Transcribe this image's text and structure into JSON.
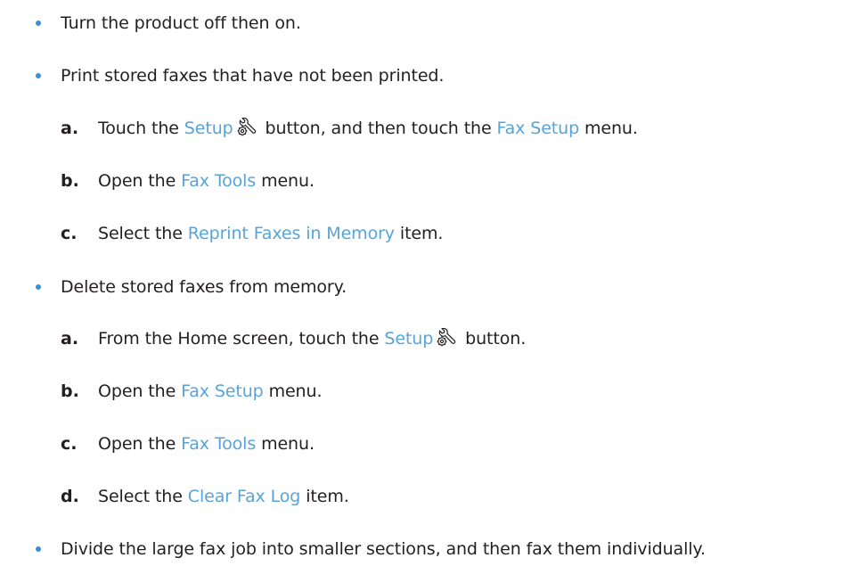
{
  "steps": [
    {
      "text": "Turn the product off then on."
    },
    {
      "text": "Print stored faxes that have not been printed.",
      "sub": [
        {
          "letter": "a.",
          "pre": "Touch the ",
          "ui1": "Setup",
          "mid": " button, and then touch the ",
          "ui2": "Fax Setup",
          "post": " menu.",
          "icon": "wrench-gear-icon"
        },
        {
          "letter": "b.",
          "pre": "Open the ",
          "ui1": "Fax Tools",
          "post": " menu."
        },
        {
          "letter": "c.",
          "pre": "Select the ",
          "ui1": "Reprint Faxes in Memory",
          "post": " item."
        }
      ]
    },
    {
      "text": "Delete stored faxes from memory.",
      "sub": [
        {
          "letter": "a.",
          "pre": "From the Home screen, touch the ",
          "ui1": "Setup",
          "post": " button.",
          "icon": "wrench-gear-icon"
        },
        {
          "letter": "b.",
          "pre": "Open the ",
          "ui1": "Fax Setup",
          "post": " menu."
        },
        {
          "letter": "c.",
          "pre": "Open the ",
          "ui1": "Fax Tools",
          "post": " menu."
        },
        {
          "letter": "d.",
          "pre": "Select the ",
          "ui1": "Clear Fax Log",
          "post": " item."
        }
      ]
    },
    {
      "text": "Divide the large fax job into smaller sections, and then fax them individually."
    }
  ],
  "colors": {
    "ui_term": "#58a3d8",
    "bullet": "#3b8fd4",
    "text": "#231f20"
  }
}
